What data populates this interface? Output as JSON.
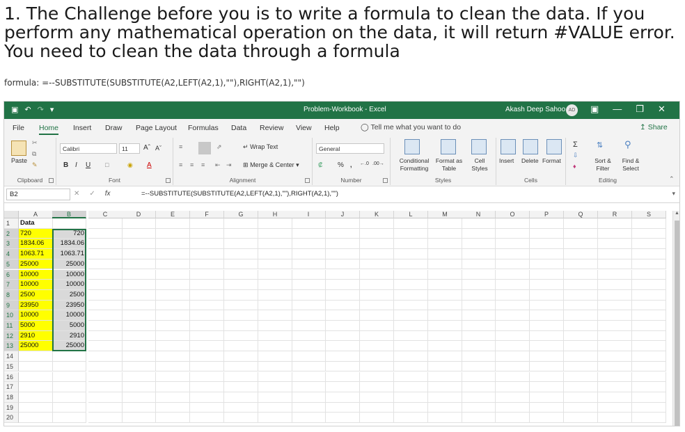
{
  "heading": "1. The Challenge before you is to write a formula to clean the data. If you perform any mathematical operation on the data, it will return #VALUE error. You need to clean the data through a formula",
  "formula_note": "formula: =--SUBSTITUTE(SUBSTITUTE(A2,LEFT(A2,1),\"\"),RIGHT(A2,1),\"\")",
  "excel": {
    "workbook_title": "Problem-Workbook - Excel",
    "user_name": "Akash Deep Sahoo",
    "user_initials": "AD",
    "tabs": [
      "File",
      "Home",
      "Insert",
      "Draw",
      "Page Layout",
      "Formulas",
      "Data",
      "Review",
      "View",
      "Help"
    ],
    "active_tab": "Home",
    "tell_me": "Tell me what you want to do",
    "share": "Share",
    "ribbon": {
      "clipboard": "Clipboard",
      "paste": "Paste",
      "font": "Font",
      "font_name": "Calibri",
      "font_size": "11",
      "alignment": "Alignment",
      "wrap_text": "Wrap Text",
      "merge_center": "Merge & Center",
      "number": "Number",
      "number_format": "General",
      "styles": "Styles",
      "conditional_formatting": "Conditional Formatting",
      "format_as_table": "Format as Table",
      "cell_styles": "Cell Styles",
      "cells": "Cells",
      "insert": "Insert",
      "delete": "Delete",
      "format": "Format",
      "editing": "Editing",
      "sort_filter": "Sort & Filter",
      "find_select": "Find & Select"
    },
    "name_box": "B2",
    "formula_bar": "=--SUBSTITUTE(SUBSTITUTE(A2,LEFT(A2,1),\"\"),RIGHT(A2,1),\"\")",
    "columns": [
      "A",
      "B",
      "C",
      "D",
      "E",
      "F",
      "G",
      "H",
      "I",
      "J",
      "K",
      "L",
      "M",
      "N",
      "O",
      "P",
      "Q",
      "R",
      "S"
    ],
    "selected_column": "B",
    "row_numbers": [
      "1",
      "2",
      "3",
      "4",
      "5",
      "6",
      "7",
      "8",
      "9",
      "10",
      "11",
      "12",
      "13",
      "14",
      "15",
      "16",
      "17",
      "18",
      "19",
      "20"
    ],
    "col_a": [
      "Data",
      "720",
      "1834.06",
      "1063.71",
      "25000",
      "10000",
      "10000",
      "2500",
      "23950",
      "10000",
      "5000",
      "2910",
      "25000"
    ],
    "col_b": [
      "",
      "720",
      "1834.06",
      "1063.71",
      "25000",
      "10000",
      "10000",
      "2500",
      "23950",
      "10000",
      "5000",
      "2910",
      "25000"
    ]
  }
}
